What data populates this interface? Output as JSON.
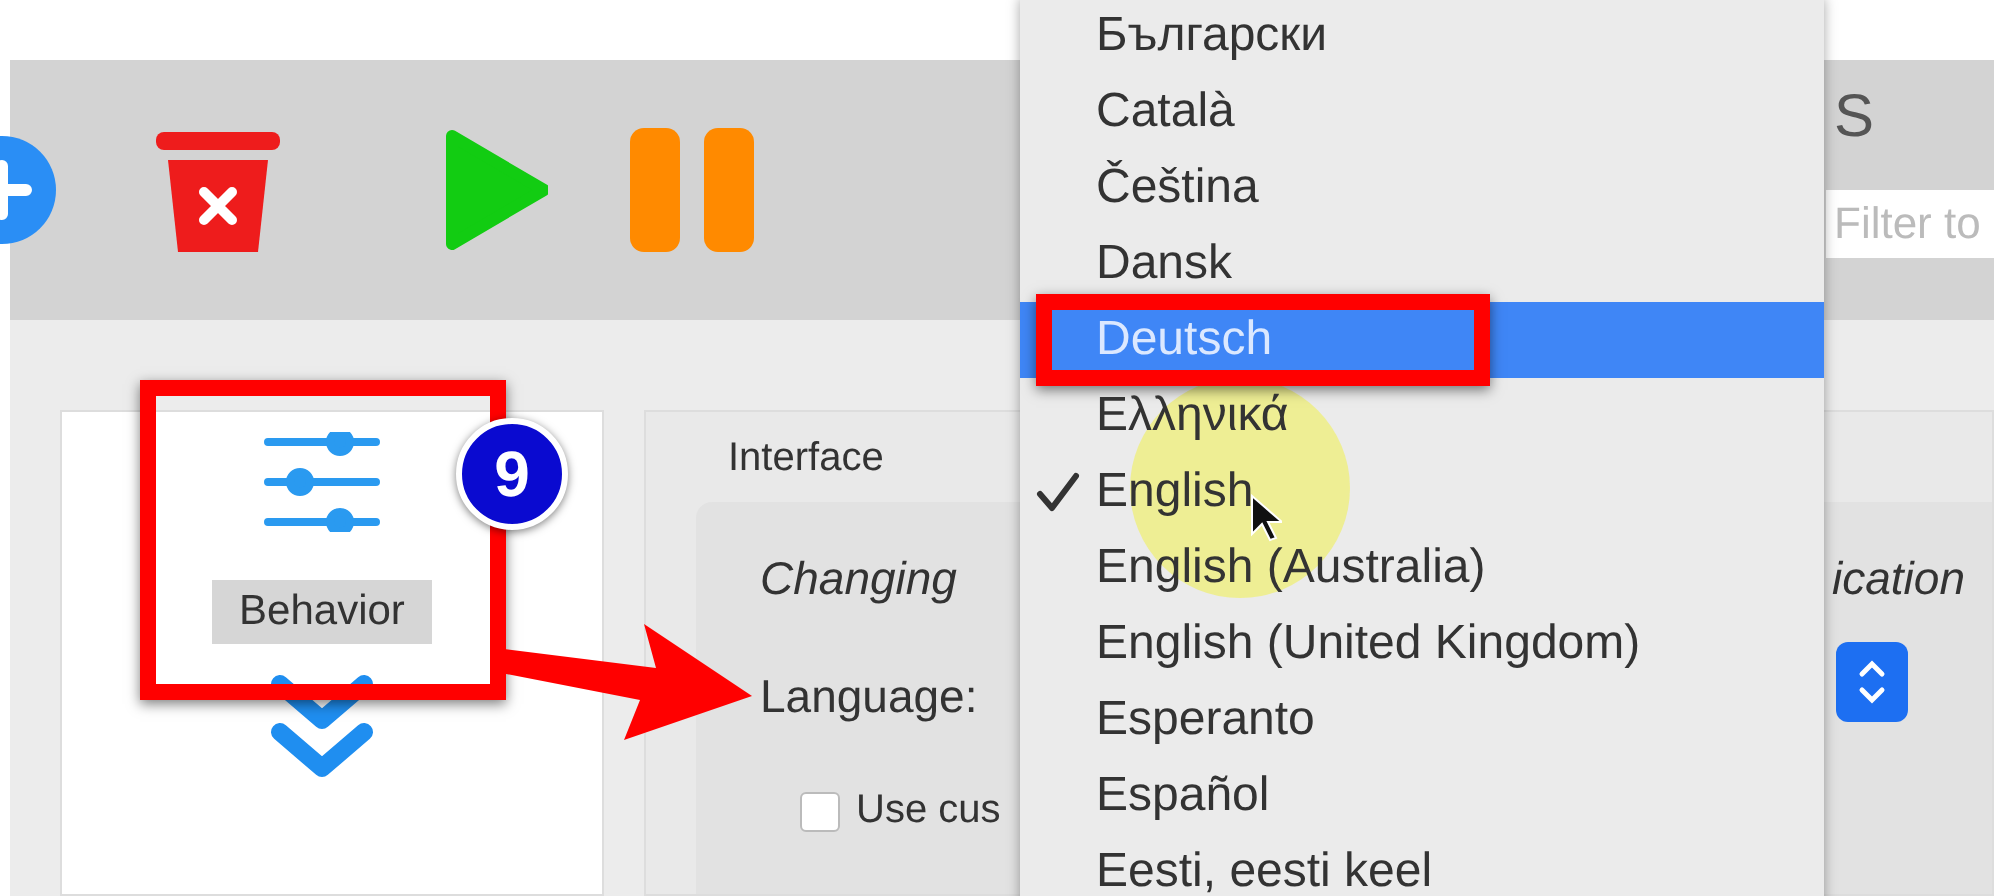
{
  "toolbar": {
    "label": "S",
    "filter": {
      "placeholder": "Filter to"
    }
  },
  "sidebar": {
    "items": [
      {
        "label": "Behavior",
        "selected": true
      }
    ]
  },
  "section": {
    "title": "Interface",
    "note": "Changing",
    "note_end": "ication",
    "language_label": "Language:",
    "custom_option": {
      "label": "Use cus",
      "checked": false
    }
  },
  "language_menu": {
    "items": [
      {
        "label": "Български",
        "selected": false,
        "checked": false
      },
      {
        "label": "Català",
        "selected": false,
        "checked": false
      },
      {
        "label": "Čeština",
        "selected": false,
        "checked": false
      },
      {
        "label": "Dansk",
        "selected": false,
        "checked": false
      },
      {
        "label": "Deutsch",
        "selected": true,
        "checked": false
      },
      {
        "label": "Ελληνικά",
        "selected": false,
        "checked": false
      },
      {
        "label": "English",
        "selected": false,
        "checked": true
      },
      {
        "label": "English (Australia)",
        "selected": false,
        "checked": false
      },
      {
        "label": "English (United Kingdom)",
        "selected": false,
        "checked": false
      },
      {
        "label": "Esperanto",
        "selected": false,
        "checked": false
      },
      {
        "label": "Español",
        "selected": false,
        "checked": false
      },
      {
        "label": "Eesti, eesti keel",
        "selected": false,
        "checked": false
      }
    ]
  },
  "annotation": {
    "badge": "9"
  }
}
